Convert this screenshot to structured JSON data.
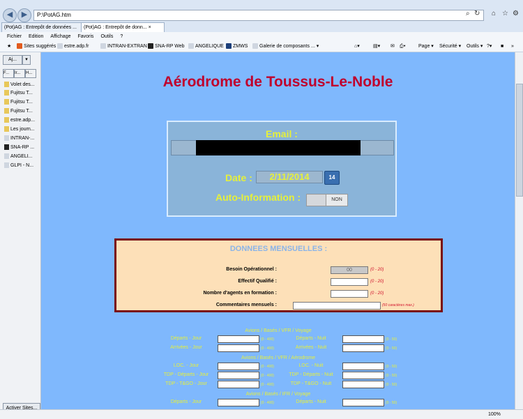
{
  "browser": {
    "url": "P:\\PotAG.htm",
    "tabs": [
      "(Pot)AG : Entrepôt de données ...",
      "(Pot)AG : Entrepôt de donn... ×"
    ],
    "menu": [
      "Fichier",
      "Edition",
      "Affichage",
      "Favoris",
      "Outils",
      "?"
    ],
    "favorites": [
      "Sites suggérés ▾",
      "estre.adp.fr",
      "INTRAN-EXTRAN",
      "SNA-RP Web",
      "ANGELIQUE",
      "ZMWS",
      "Galerie de composants ... ▾"
    ],
    "toolbar": [
      "Page ▾",
      "Sécurité ▾",
      "Outils ▾"
    ],
    "zoom": "100%"
  },
  "leftpane": {
    "add_button": "Aj...",
    "tabs": [
      "F...",
      "Ir...",
      "H..."
    ],
    "items": [
      "Volet des...",
      "Fujitsu T...",
      "Fujitsu T...",
      "Fujitsu T...",
      "estre.adp...",
      "Les journ...",
      "INTRAN-...",
      "SNA-RP ...",
      "ANGELI...",
      "GLPI - N..."
    ],
    "activate": "Activer Sites..."
  },
  "page": {
    "title": "Aérodrome de Toussus-Le-Noble",
    "email_label": "Email :",
    "date_label": "Date :",
    "date_value": "2/11/2014",
    "calendar_icon_text": "14",
    "auto_label": "Auto-Information :",
    "auto_value": "NON"
  },
  "monthly": {
    "title": "DONNEES MENSUELLES :",
    "rows": [
      {
        "label": "Besoin Opérationnel :",
        "value": "00",
        "range": "(0 - 20)"
      },
      {
        "label": "Effectif Qualifié :",
        "value": "",
        "range": "(0 - 20)"
      },
      {
        "label": "Nombre d'agents en formation :",
        "value": "",
        "range": "(0 - 20)"
      }
    ],
    "comments_label": "Commentaires mensuels :",
    "comments_range": "(50 caractères max.)"
  },
  "flights": {
    "sections": [
      "Avions / Basés / VFR / Voyage",
      "Avions / Basés / VFR / Aérodrome",
      "Avions / Basés / IFR / Voyage"
    ],
    "day_range": "(0 - 400)",
    "night_range": "(0 - 50)",
    "rows": [
      {
        "section": 0,
        "left": "Départs - Jour",
        "right": "Départs - Nuit"
      },
      {
        "section": 0,
        "left": "Arrivées - Jour",
        "right": "Arrivées - Nuit"
      },
      {
        "section": 1,
        "left": "LOC. - Jour",
        "right": "LOC. - Nuit"
      },
      {
        "section": 1,
        "left": "TDP - Départs - Jour",
        "right": "TDP - Départs - Nuit"
      },
      {
        "section": 1,
        "left": "TDP - T&GO - Jour",
        "right": "TDP - T&GO - Nuit"
      },
      {
        "section": 2,
        "left": "Départs - Jour",
        "right": "Départs - Nuit"
      }
    ]
  }
}
